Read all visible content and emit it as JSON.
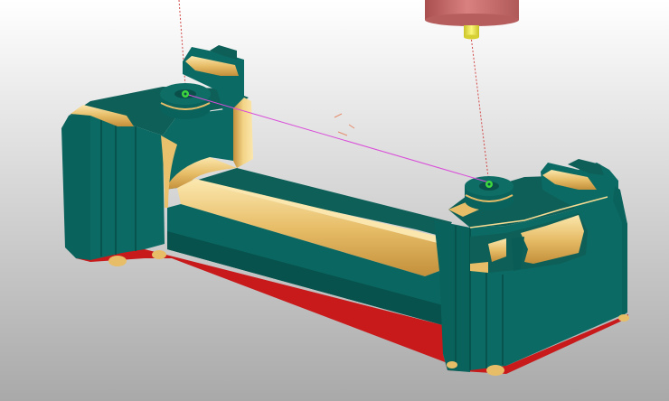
{
  "viewport": {
    "background_top": "#ffffff",
    "background_bottom": "#a9a9a9"
  },
  "colors": {
    "part_face": "#0b6b64",
    "part_face_dark": "#064d48",
    "part_face_mid": "#0e5f58",
    "fillet_light": "#f7dc93",
    "fillet_mid": "#e9c06c",
    "fillet_dark": "#c9973f",
    "base_stripe": "#c8191b",
    "tool_body": "#c66a6a",
    "tool_tip": "#e8e34a",
    "toolpath_line": "#d94cd9",
    "rapid_line": "#d24a4a",
    "selection_marker": "#3ed63e"
  },
  "objects": {
    "workpiece": "milled-part",
    "tool": "cutting-tool",
    "path": "toolpath-segment",
    "markers": [
      "pick-point-marker",
      "pick-point-marker"
    ]
  }
}
